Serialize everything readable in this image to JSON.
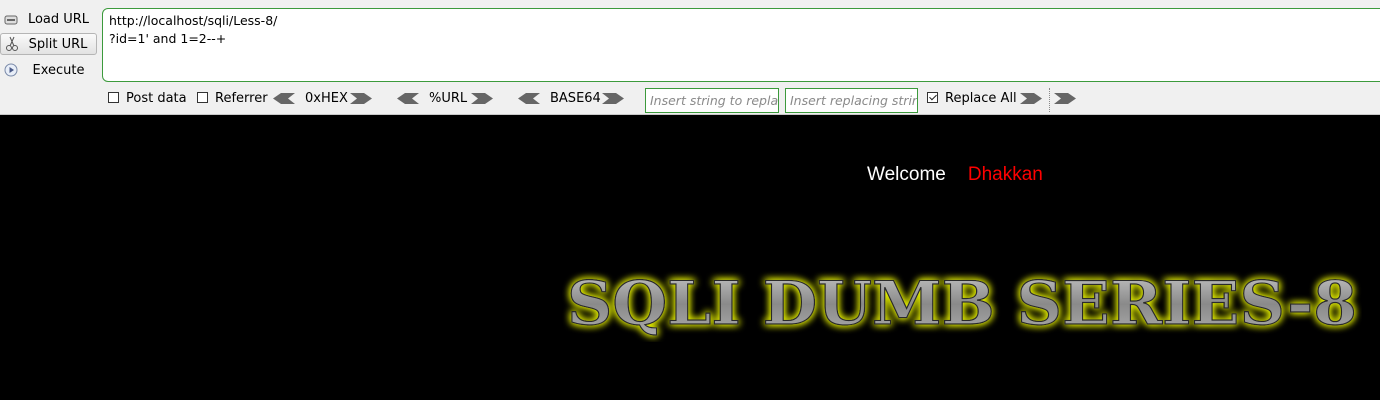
{
  "sidebar": {
    "load_label": "Load URL",
    "split_label": "Split URL",
    "execute_label": "Execute"
  },
  "url_text": "http://localhost/sqli/Less-8/\n?id=1' and 1=2--+",
  "options": {
    "post_data_label": "Post data",
    "referrer_label": "Referrer",
    "hex_label": "0xHEX",
    "url_enc_label": "%URL",
    "base64_label": "BASE64",
    "find_placeholder": "Insert string to replace",
    "replace_placeholder": "Insert replacing string",
    "replace_all_label": "Replace All",
    "post_data_checked": false,
    "referrer_checked": false,
    "replace_all_checked": true
  },
  "page": {
    "welcome": "Welcome",
    "name": "Dhakkan",
    "banner": "SQLI DUMB SERIES-8"
  }
}
